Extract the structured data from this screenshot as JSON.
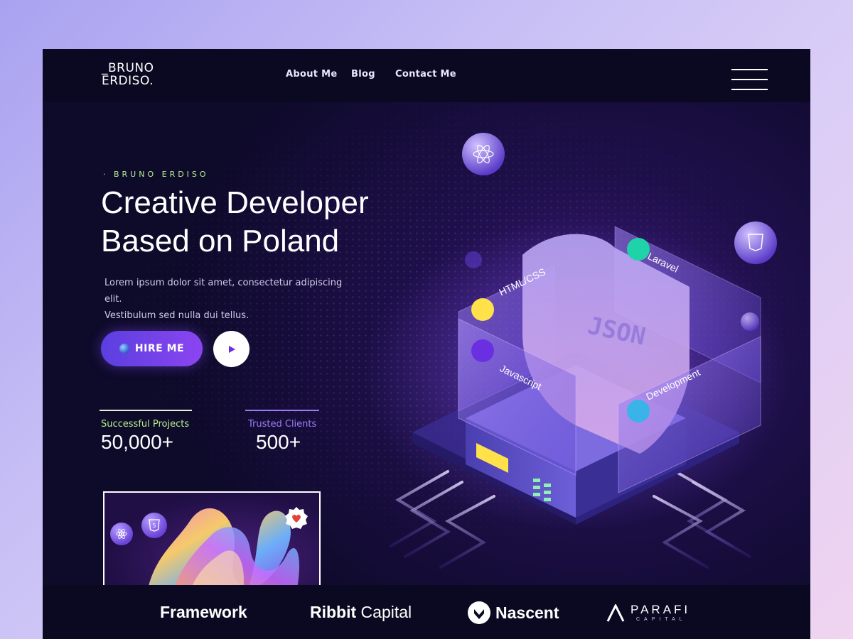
{
  "logo": {
    "line1": "_BRUNO",
    "line2": "ERDISO."
  },
  "nav": {
    "items": [
      {
        "label": "About Me"
      },
      {
        "label": "Blog"
      },
      {
        "label": "Contact Me"
      }
    ]
  },
  "hero": {
    "eyebrow": "· BRUNO ERDISO",
    "title_line1": "Creative Developer",
    "title_line2": "Based on Poland",
    "description_line1": "Lorem ipsum dolor sit amet, consectetur adipiscing elit.",
    "description_line2": "Vestibulum sed nulla dui tellus.",
    "hire_label": "HIRE ME"
  },
  "stats": [
    {
      "label": "Successful Projects",
      "value": "50,000+",
      "label_color": "#b7f08c",
      "line_color": "#e8ecd8"
    },
    {
      "label": "Trusted Clients",
      "value": "500+",
      "label_color": "#9c7cf5",
      "line_color": "#9c7cf5"
    }
  ],
  "illustration": {
    "panels": [
      "HTML/CSS",
      "Laravel",
      "Javascript",
      "Development"
    ],
    "shield_text": "JSON"
  },
  "partners": [
    {
      "name": "Framework"
    },
    {
      "name_bold": "Ribbit",
      "name_light": "Capital"
    },
    {
      "name": "Nascent"
    },
    {
      "name": "PARAFI",
      "sub": "CAPITAL"
    }
  ],
  "colors": {
    "accent_purple": "#7b45f0",
    "accent_green": "#b7f08c",
    "bg_dark": "#0e0a2a"
  }
}
